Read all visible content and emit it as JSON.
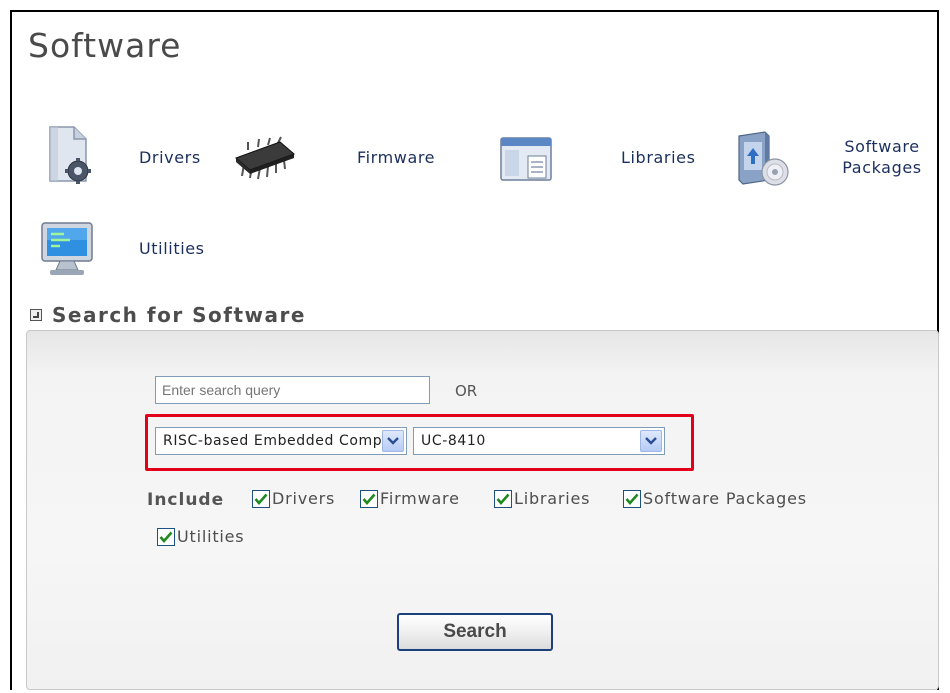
{
  "page": {
    "title": "Software"
  },
  "categories": [
    {
      "label": "Drivers",
      "icon": "driver-document-gear-icon"
    },
    {
      "label": "Firmware",
      "icon": "microchip-icon"
    },
    {
      "label": "Libraries",
      "icon": "library-window-icon"
    },
    {
      "label_line1": "Software",
      "label_line2": "Packages",
      "icon": "software-package-cd-icon"
    },
    {
      "label": "Utilities",
      "icon": "monitor-icon"
    }
  ],
  "search": {
    "section_title": "Search for Software",
    "query_placeholder": "Enter search query",
    "or_text": "OR",
    "category_select_value": "RISC-based Embedded Computers",
    "model_select_value": "UC-8410",
    "include_label": "Include",
    "include_options": [
      {
        "label": "Drivers",
        "checked": true
      },
      {
        "label": "Firmware",
        "checked": true
      },
      {
        "label": "Libraries",
        "checked": true
      },
      {
        "label": "Software Packages",
        "checked": true
      },
      {
        "label": "Utilities",
        "checked": true
      }
    ],
    "submit_label": "Search"
  },
  "colors": {
    "link_text": "#1b2f5e",
    "highlight_border": "#e3001b",
    "checkbox_check": "#1f8a1f"
  }
}
